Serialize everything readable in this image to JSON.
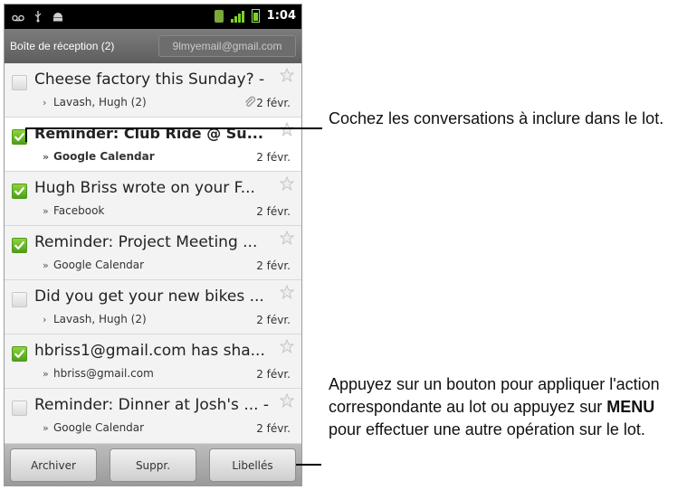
{
  "status_bar": {
    "time": "1:04"
  },
  "title_bar": {
    "folder_label": "Boîte de réception (2)",
    "account": "9lmyemail@gmail.com"
  },
  "conversations": [
    {
      "subject": "Cheese factory this Sunday? - ...",
      "sender": "Lavash, Hugh (2)",
      "marker": "›",
      "date": "2 févr.",
      "checked": false,
      "unread": false,
      "attachment": true
    },
    {
      "subject": "Reminder: Club Ride @ Su...",
      "sender": "Google Calendar",
      "marker": "»",
      "date": "2 févr.",
      "checked": true,
      "unread": true,
      "attachment": false
    },
    {
      "subject": "Hugh Briss wrote on your F...",
      "sender": "Facebook",
      "marker": "»",
      "date": "2 févr.",
      "checked": true,
      "unread": false,
      "attachment": false
    },
    {
      "subject": "Reminder: Project Meeting ...",
      "sender": "Google Calendar",
      "marker": "»",
      "date": "2 févr.",
      "checked": true,
      "unread": false,
      "attachment": false
    },
    {
      "subject": "Did you get your new bikes ...",
      "sender": "Lavash, Hugh (2)",
      "marker": "›",
      "date": "2 févr.",
      "checked": false,
      "unread": false,
      "attachment": false
    },
    {
      "subject": "hbriss1@gmail.com has sha...",
      "sender": "hbriss@gmail.com",
      "marker": "»",
      "date": "2 févr.",
      "checked": true,
      "unread": false,
      "attachment": false
    },
    {
      "subject": "Reminder: Dinner at Josh's ... -...",
      "sender": "Google Calendar",
      "marker": "»",
      "date": "2 févr.",
      "checked": false,
      "unread": false,
      "attachment": false
    }
  ],
  "actions": {
    "archive": "Archiver",
    "delete": "Suppr.",
    "labels": "Libellés"
  },
  "callouts": {
    "checkbox_note": "Cochez les conversations à inclure dans le lot.",
    "actions_note_before": "Appuyez sur un bouton pour appliquer l'action correspondante au lot ou appuyez sur ",
    "actions_note_key": "MENU",
    "actions_note_after": " pour effectuer une autre opération sur le lot."
  },
  "colors": {
    "check_green": "#6cc02b",
    "status_bar": "#000000",
    "title_bar": "#6b6b6b"
  }
}
